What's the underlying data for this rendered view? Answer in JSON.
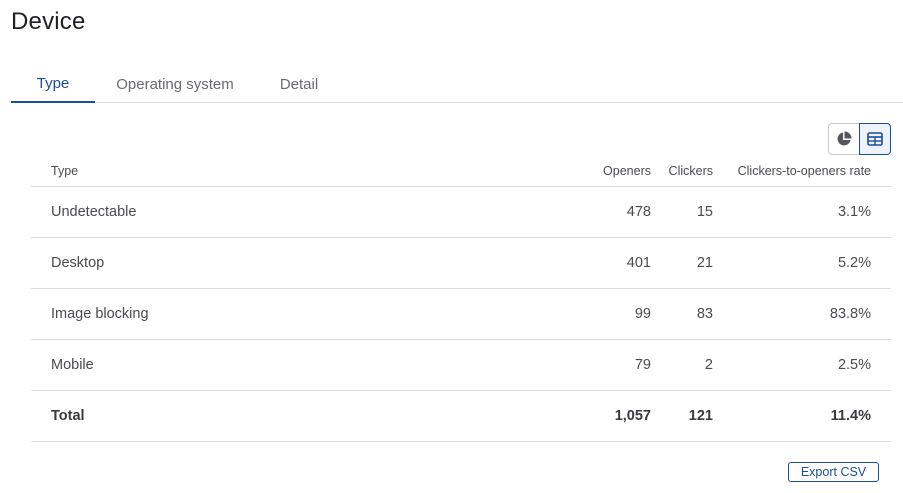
{
  "page": {
    "title": "Device"
  },
  "tabs": [
    {
      "label": "Type",
      "active": true
    },
    {
      "label": "Operating system",
      "active": false
    },
    {
      "label": "Detail",
      "active": false
    }
  ],
  "view_toggle": {
    "options": [
      {
        "icon": "pie-chart-icon",
        "selected": false
      },
      {
        "icon": "table-icon",
        "selected": true
      }
    ]
  },
  "table": {
    "headers": {
      "type": "Type",
      "openers": "Openers",
      "clickers": "Clickers",
      "rate": "Clickers-to-openers rate"
    },
    "rows": [
      {
        "type": "Undetectable",
        "openers": "478",
        "clickers": "15",
        "rate": "3.1%"
      },
      {
        "type": "Desktop",
        "openers": "401",
        "clickers": "21",
        "rate": "5.2%"
      },
      {
        "type": "Image blocking",
        "openers": "99",
        "clickers": "83",
        "rate": "83.8%"
      },
      {
        "type": "Mobile",
        "openers": "79",
        "clickers": "2",
        "rate": "2.5%"
      }
    ],
    "total": {
      "type": "Total",
      "openers": "1,057",
      "clickers": "121",
      "rate": "11.4%"
    }
  },
  "actions": {
    "export_label": "Export CSV"
  },
  "colors": {
    "accent": "#1b4d99",
    "divider": "#dcdcdf",
    "text": "#4a4a50"
  }
}
